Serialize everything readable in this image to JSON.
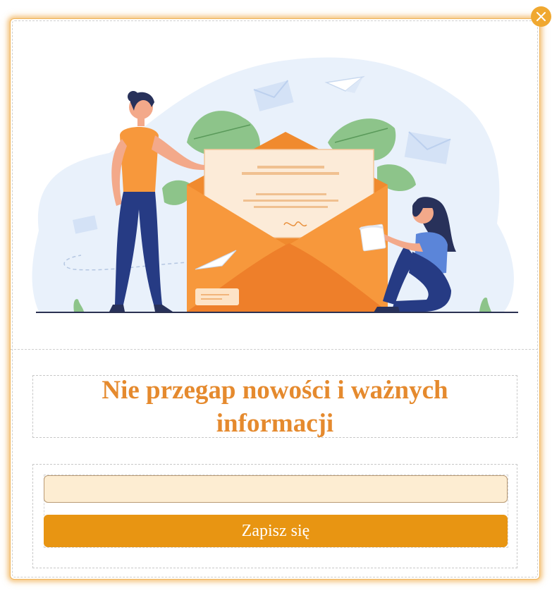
{
  "popup": {
    "title": "Nie przegap nowości i ważnych informacji",
    "email_placeholder": "",
    "email_value": "",
    "submit_label": "Zapisz się",
    "close_icon": "close-icon",
    "illustration": "newsletter-envelope-illustration"
  },
  "colors": {
    "accent": "#e89512",
    "title": "#e58a2e",
    "input_bg": "#fdedd2",
    "close_bg": "#f0a830"
  }
}
